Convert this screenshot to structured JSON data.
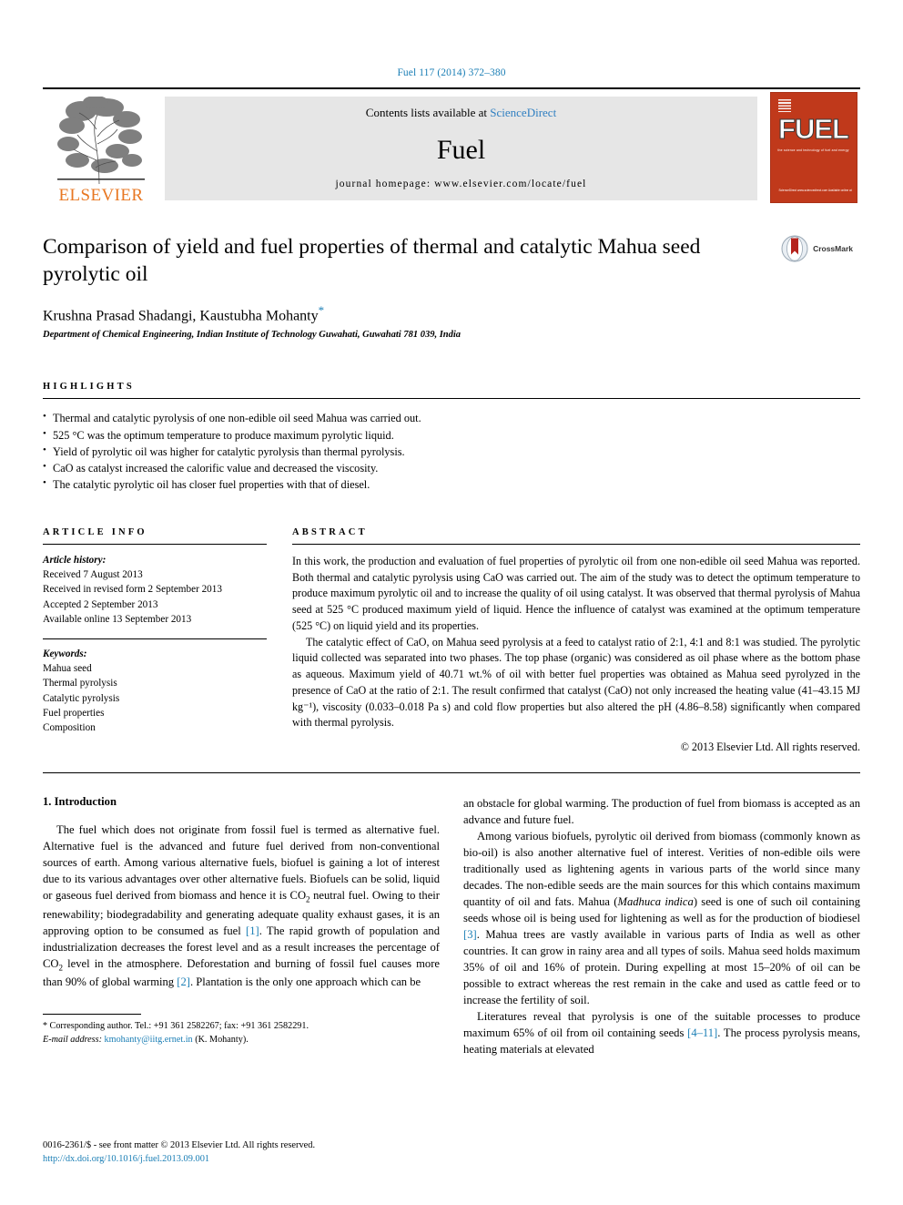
{
  "running_head": "Fuel 117 (2014) 372–380",
  "masthead": {
    "publisher": "ELSEVIER",
    "contents_prefix": "Contents lists available at ",
    "contents_link": "ScienceDirect",
    "journal_name": "Fuel",
    "homepage": "journal homepage: www.elsevier.com/locate/fuel",
    "cover_title": "FUEL",
    "cover_subtitle": "the science and technology of fuel and energy",
    "cover_footer": "ScienceDirect  www.sciencedirect.com\nAvailable online at"
  },
  "title": "Comparison of yield and fuel properties of thermal and catalytic Mahua seed pyrolytic oil",
  "crossmark_label": "CrossMark",
  "authors": "Krushna Prasad Shadangi, Kaustubha Mohanty",
  "author_star": "*",
  "affiliation": "Department of Chemical Engineering, Indian Institute of Technology Guwahati, Guwahati 781 039, India",
  "highlights": {
    "heading": "HIGHLIGHTS",
    "items": [
      "Thermal and catalytic pyrolysis of one non-edible oil seed Mahua was carried out.",
      "525 °C was the optimum temperature to produce maximum pyrolytic liquid.",
      "Yield of pyrolytic oil was higher for catalytic pyrolysis than thermal pyrolysis.",
      "CaO as catalyst increased the calorific value and decreased the viscosity.",
      "The catalytic pyrolytic oil has closer fuel properties with that of diesel."
    ]
  },
  "article_info": {
    "heading": "ARTICLE INFO",
    "history_label": "Article history:",
    "history": [
      "Received 7 August 2013",
      "Received in revised form 2 September 2013",
      "Accepted 2 September 2013",
      "Available online 13 September 2013"
    ],
    "keywords_label": "Keywords:",
    "keywords": [
      "Mahua seed",
      "Thermal pyrolysis",
      "Catalytic pyrolysis",
      "Fuel properties",
      "Composition"
    ]
  },
  "abstract": {
    "heading": "ABSTRACT",
    "paragraph_1": "In this work, the production and evaluation of fuel properties of pyrolytic oil from one non-edible oil seed Mahua was reported. Both thermal and catalytic pyrolysis using CaO was carried out. The aim of the study was to detect the optimum temperature to produce maximum pyrolytic oil and to increase the quality of oil using catalyst. It was observed that thermal pyrolysis of Mahua seed at 525 °C produced maximum yield of liquid. Hence the influence of catalyst was examined at the optimum temperature (525 °C) on liquid yield and its properties.",
    "paragraph_2": "The catalytic effect of CaO, on Mahua seed pyrolysis at a feed to catalyst ratio of 2:1, 4:1 and 8:1 was studied. The pyrolytic liquid collected was separated into two phases. The top phase (organic) was considered as oil phase where as the bottom phase as aqueous. Maximum yield of 40.71 wt.% of oil with better fuel properties was obtained as Mahua seed pyrolyzed in the presence of CaO at the ratio of 2:1. The result confirmed that catalyst (CaO) not only increased the heating value (41–43.15 MJ kg⁻¹), viscosity (0.033–0.018 Pa s) and cold flow properties but also altered the pH (4.86–8.58) significantly when compared with thermal pyrolysis.",
    "copyright": "© 2013 Elsevier Ltd. All rights reserved."
  },
  "introduction": {
    "heading": "1. Introduction",
    "left_p1_a": "The fuel which does not originate from fossil fuel is termed as alternative fuel. Alternative fuel is the advanced and future fuel derived from non-conventional sources of earth. Among various alternative fuels, biofuel is gaining a lot of interest due to its various advantages over other alternative fuels. Biofuels can be solid, liquid or gaseous fuel derived from biomass and hence it is CO",
    "left_p1_sub1": "2",
    "left_p1_b": " neutral fuel. Owing to their renewability; biodegradability and generating adequate quality exhaust gases, it is an approving option to be consumed as fuel ",
    "left_ref1": "[1]",
    "left_p1_c": ". The rapid growth of population and industrialization decreases the forest level and as a result increases the percentage of CO",
    "left_p1_sub2": "2",
    "left_p1_d": " level in the atmosphere. Deforestation and burning of fossil fuel causes more than 90% of global warming ",
    "left_ref2": "[2]",
    "left_p1_e": ". Plantation is the only one approach which can be",
    "right_p1": "an obstacle for global warming. The production of fuel from biomass is accepted as an advance and future fuel.",
    "right_p2_a": "Among various biofuels, pyrolytic oil derived from biomass (commonly known as bio-oil) is also another alternative fuel of interest. Verities of non-edible oils were traditionally used as lightening agents in various parts of the world since many decades. The non-edible seeds are the main sources for this which contains maximum quantity of oil and fats. Mahua (",
    "right_p2_italic": "Madhuca indica",
    "right_p2_b": ") seed is one of such oil containing seeds whose oil is being used for lightening as well as for the production of biodiesel ",
    "right_ref3": "[3]",
    "right_p2_c": ". Mahua trees are vastly available in various parts of India as well as other countries. It can grow in rainy area and all types of soils. Mahua seed holds maximum 35% of oil and 16% of protein. During expelling at most 15–20% of oil can be possible to extract whereas the rest remain in the cake and used as cattle feed or to increase the fertility of soil.",
    "right_p3_a": "Literatures reveal that pyrolysis is one of the suitable processes to produce maximum 65% of oil from oil containing seeds ",
    "right_ref4": "[4–11]",
    "right_p3_b": ". The process pyrolysis means, heating materials at elevated"
  },
  "footnote": {
    "star": "*",
    "corresponding": " Corresponding author. Tel.: +91 361 2582267; fax: +91 361 2582291.",
    "email_label": "E-mail address:",
    "email": "kmohanty@iitg.ernet.in",
    "email_suffix": " (K. Mohanty)."
  },
  "bottom": {
    "issn_line": "0016-2361/$ - see front matter © 2013 Elsevier Ltd. All rights reserved.",
    "doi": "http://dx.doi.org/10.1016/j.fuel.2013.09.001"
  },
  "colors": {
    "link": "#1a7eb5",
    "elsevier_orange": "#e87722",
    "cover_red": "#c0391b",
    "sciencedirect_blue": "#2f7fc1"
  }
}
